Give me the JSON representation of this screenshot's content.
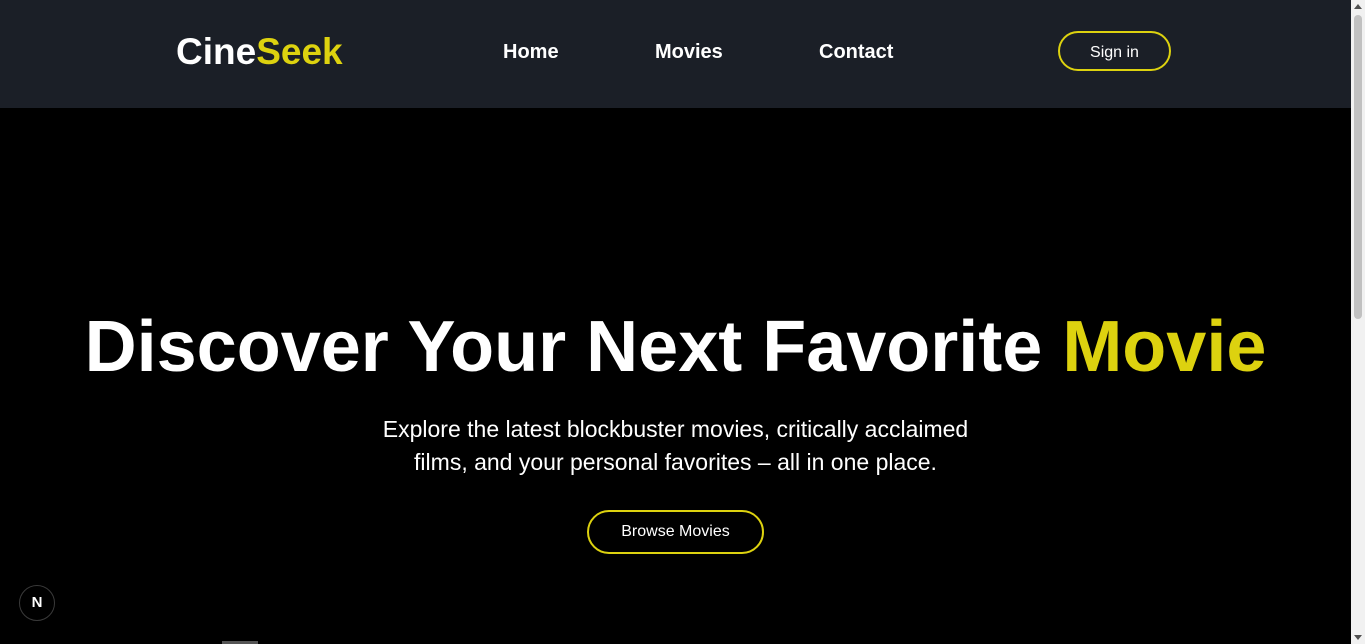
{
  "header": {
    "logo": {
      "part_a": "Cine",
      "part_b": "Seek"
    },
    "nav": {
      "home": "Home",
      "movies": "Movies",
      "contact": "Contact"
    },
    "sign_in_label": "Sign in"
  },
  "hero": {
    "title_main": "Discover Your Next Favorite ",
    "title_accent": "Movie",
    "subtitle": "Explore the latest blockbuster movies, critically acclaimed films, and your personal favorites – all in one place.",
    "browse_label": "Browse Movies"
  },
  "dev_badge": {
    "label": "N",
    "icon": "nextjs-icon"
  },
  "colors": {
    "accent": "#ddd20f",
    "header_bg": "#1b1f27",
    "page_bg": "#000000",
    "text": "#ffffff"
  }
}
